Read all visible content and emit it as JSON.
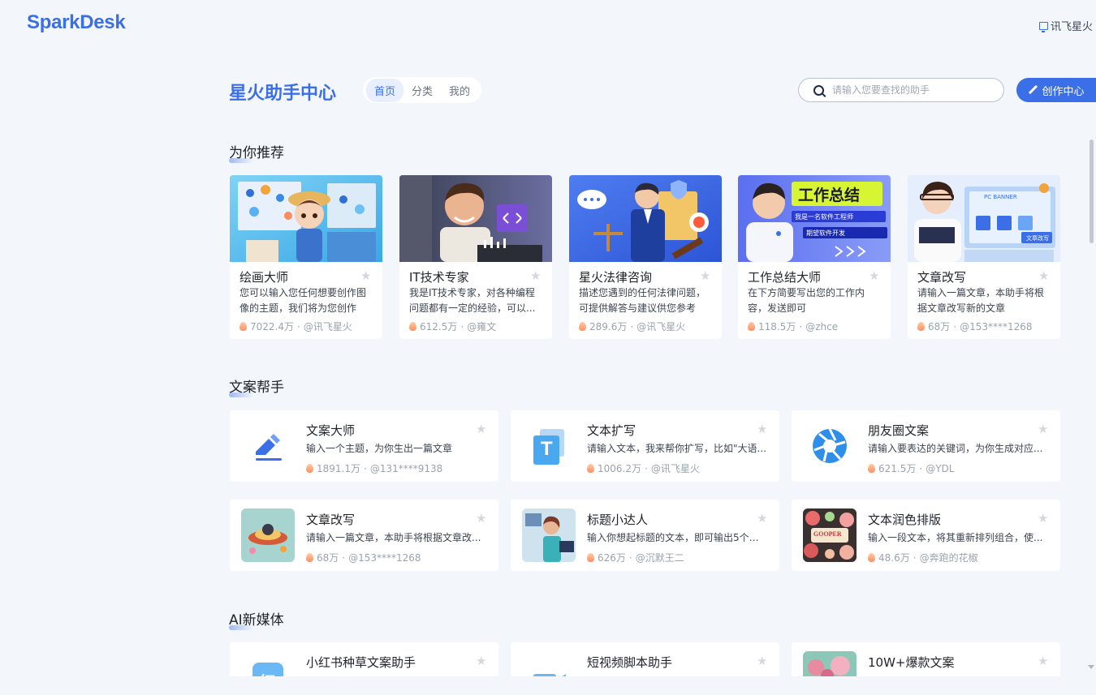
{
  "brand": "SparkDesk",
  "top_right": "讯飞星火",
  "header": {
    "title": "星火助手中心",
    "tabs": [
      "首页",
      "分类",
      "我的"
    ],
    "search_placeholder": "请输入您要查找的助手",
    "create_label": "创作中心"
  },
  "sections": {
    "recommend": "为你推荐",
    "copywriting": "文案帮手",
    "ai_media": "AI新媒体"
  },
  "recommend": [
    {
      "name": "绘画大师",
      "desc": "您可以输入您任何想要创作图像的主题，我们将为您创作",
      "hot": "7022.4万",
      "author": "@讯飞星火"
    },
    {
      "name": "IT技术专家",
      "desc": "我是IT技术专家，对各种编程问题都有一定的经验，可以...",
      "hot": "612.5万",
      "author": "@雍文"
    },
    {
      "name": "星火法律咨询",
      "desc": "描述您遇到的任何法律问题，可提供解答与建议供您参考",
      "hot": "289.6万",
      "author": "@讯飞星火"
    },
    {
      "name": "工作总结大师",
      "desc": "在下方简要写出您的工作内容，发送即可",
      "hot": "118.5万",
      "author": "@zhce"
    },
    {
      "name": "文章改写",
      "desc": "请输入一篇文章，本助手将根据文章改写新的文章",
      "hot": "68万",
      "author": "@153****1268"
    }
  ],
  "recommend_banner_text": {
    "work_title": "工作总结",
    "work_line1": "我是一名软件工程师",
    "work_line2": "期望软件开发",
    "pc_banner": "PC BANNER",
    "article_rewrite": "文章改写"
  },
  "copywriting": [
    {
      "name": "文案大师",
      "desc": "输入一个主题，为你生出一篇文章",
      "hot": "1891.1万",
      "author": "@131****9138"
    },
    {
      "name": "文本扩写",
      "desc": "请输入文本，我来帮你扩写，比如\"大语...",
      "hot": "1006.2万",
      "author": "@讯飞星火"
    },
    {
      "name": "朋友圈文案",
      "desc": "请输入要表达的关键词，为你生成对应...",
      "hot": "621.5万",
      "author": "@YDL"
    },
    {
      "name": "文章改写",
      "desc": "请输入一篇文章，本助手将根据文章改...",
      "hot": "68万",
      "author": "@153****1268"
    },
    {
      "name": "标题小达人",
      "desc": "输入你想起标题的文本，即可输出5个文...",
      "hot": "626万",
      "author": "@沉默王二"
    },
    {
      "name": "文本润色排版",
      "desc": "输入一段文本，将其重新排列组合，使...",
      "hot": "48.6万",
      "author": "@奔跑的花椒"
    }
  ],
  "ai_media": [
    {
      "name": "小红书种草文案助手"
    },
    {
      "name": "短视频脚本助手"
    },
    {
      "name": "10W+爆款文案"
    }
  ],
  "icon_text": {
    "textbox_t": "T",
    "red_book": "红",
    "gooper": "GOOPER"
  }
}
